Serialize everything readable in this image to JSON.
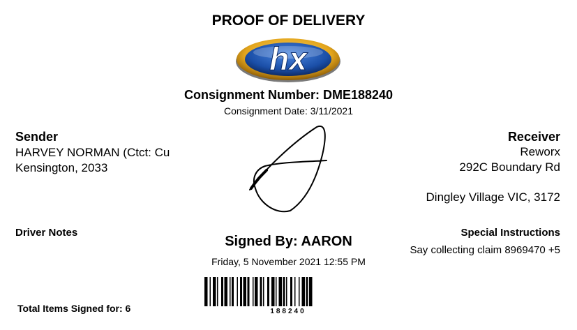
{
  "document": {
    "title": "PROOF OF DELIVERY",
    "logo_text": "hx",
    "consignment_number": "Consignment Number: DME188240",
    "consignment_date": "Consignment Date: 3/11/2021"
  },
  "sender": {
    "heading": "Sender",
    "line1": "HARVEY NORMAN (Ctct: Cu",
    "line2": "Kensington, 2033"
  },
  "receiver": {
    "heading": "Receiver",
    "line1": "Reworx",
    "line2": "292C Boundary Rd",
    "line3": "Dingley Village VIC, 3172"
  },
  "driver_notes": {
    "heading": "Driver Notes"
  },
  "special_instructions": {
    "heading": "Special Instructions",
    "text": "Say collecting claim 8969470 +5"
  },
  "signature": {
    "signed_by": "Signed By: AARON",
    "date": "Friday, 5 November 2021 12:55 PM"
  },
  "barcode": {
    "number": "188240"
  },
  "footer": {
    "total_items": "Total Items Signed for: 6"
  },
  "colors": {
    "logo_blue": "#1b4fa8",
    "logo_gold": "#e3a51c",
    "text": "#000000"
  }
}
